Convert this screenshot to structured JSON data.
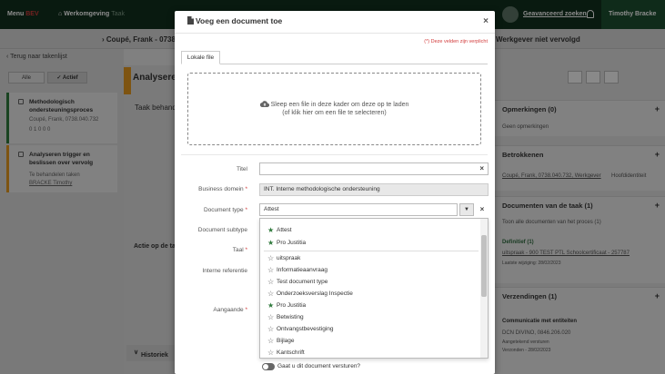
{
  "topbar": {
    "menu": "Menu",
    "menu_badge": "BEV",
    "workspace": "Werkomgeving",
    "workspace_suffix": "Taak",
    "advanced_search": "Geavanceerd zoeken",
    "user": "Timothy Bracke"
  },
  "subbar": {
    "client": "Coupé, Frank - 0738...",
    "status": "Werkgever niet vervolgd"
  },
  "leftpanel": {
    "back": "Terug naar takenlijst",
    "filter_all": "Alle",
    "filter_active": "Actief",
    "cards": [
      {
        "title": "Methodologisch ondersteuningsproces",
        "sub": "Coupé, Frank, 0738.040.732",
        "meta": "0 1 0 0 0"
      },
      {
        "title": "Analyseren trigger en beslissen over vervolg",
        "sub": "Te behandelen taken",
        "meta": "BRACKE Timothy"
      }
    ]
  },
  "main": {
    "title": "Analyseren",
    "tab": "Taak behand...",
    "actie": "Actie op de ta...",
    "historiek": "Historiek"
  },
  "rightpanel": {
    "opmerkingen": "Opmerkingen (0)",
    "geen_opmerkingen": "Geen opmerkingen",
    "betrokkenen": "Betrokkenen",
    "betrokkene_link": "Coupé, Frank, 0738.040.732, Werkgever",
    "hoofdidentiteit": "Hoofdidentiteit",
    "documenten": "Documenten van de taak (1)",
    "toon_alle": "Toon alle documenten van het proces (1)",
    "definitief": "Definitief (1)",
    "doc_link": "uitspraak - 900 TEST PTL Schoolcertificaat - 257787",
    "laatste_wijziging": "Laatste wijziging: 28/02/2023",
    "verzendingen": "Verzendingen (1)",
    "communicatie": "Communicatie met entiteiten",
    "dcn": "DCN DIVINO, 0846.206.020",
    "aangetekend": "Aangetekend versturen",
    "verzonden": "Verzonden - 28/02/2023"
  },
  "modal": {
    "title": "Voeg een document toe",
    "required_note": "(*) Deze velden zijn verplicht",
    "tab_local": "Lokale file",
    "drop_line1": "Sleep een file in deze kader om deze op te laden",
    "drop_line2": "(of klik hier om een file te selecteren)",
    "fields": {
      "titel_label": "Titel",
      "titel_value": "",
      "business_label": "Business domein",
      "business_value": "INT. Interne methodologische ondersteuning",
      "doctype_label": "Document type",
      "doctype_value": "Attest",
      "subtype_label": "Document subtype",
      "taal_label": "Taal",
      "referentie_label": "Interne referentie",
      "aangaande_label": "Aangaande"
    },
    "options": [
      {
        "label": "Attest",
        "starred": true
      },
      {
        "label": "Pro Justitia",
        "starred": true
      },
      {
        "label": "uitspraak",
        "starred": false
      },
      {
        "label": "Informatieaanvraag",
        "starred": false
      },
      {
        "label": "Test document type",
        "starred": false
      },
      {
        "label": "Onderzoeksverslag Inspectie",
        "starred": false
      },
      {
        "label": "Pro Justitia",
        "starred": true
      },
      {
        "label": "Betwisting",
        "starred": false
      },
      {
        "label": "Ontvangstbevestiging",
        "starred": false
      },
      {
        "label": "Bijlage",
        "starred": false
      },
      {
        "label": "Kantschrift",
        "starred": false
      }
    ],
    "toggle_label": "Gaat u dit document versturen?",
    "toggle_on": false
  },
  "colors": {
    "topbar": "#12301e",
    "accent_green": "#2f7a3c",
    "required_red": "#d23b3b",
    "card_orange": "#e59a1f"
  }
}
